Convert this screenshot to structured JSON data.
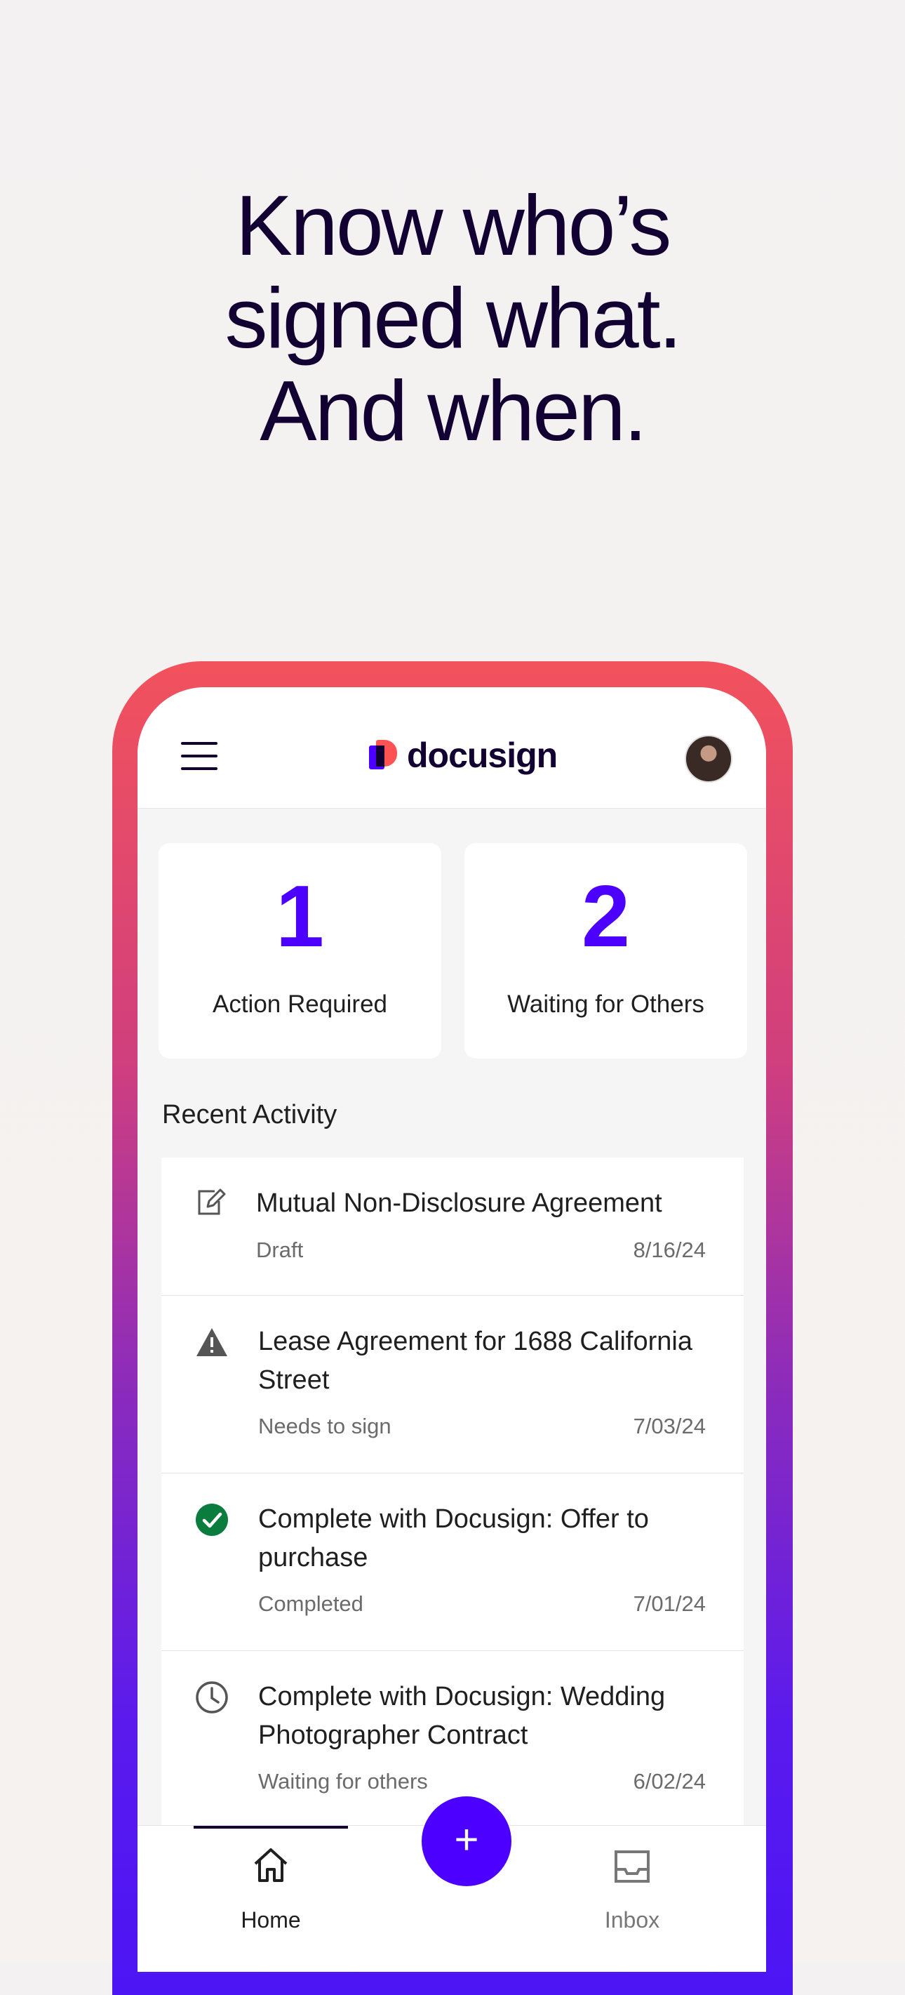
{
  "headline": {
    "line1": "Know who’s",
    "line2": "signed what.",
    "line3": "And when."
  },
  "app": {
    "logo_text": "docusign",
    "menu_icon": "hamburger-menu-icon",
    "avatar": "user-avatar"
  },
  "stats": [
    {
      "value": "1",
      "label": "Action Required"
    },
    {
      "value": "2",
      "label": "Waiting for Others"
    }
  ],
  "recent_activity": {
    "title": "Recent Activity",
    "items": [
      {
        "icon": "edit-icon",
        "title": "Mutual Non-Disclosure Agreement",
        "status": "Draft",
        "date": "8/16/24"
      },
      {
        "icon": "warning-icon",
        "title": "Lease Agreement for 1688 California Street",
        "status": "Needs to sign",
        "date": "7/03/24"
      },
      {
        "icon": "check-circle-icon",
        "title": "Complete with Docusign: Offer to purchase",
        "status": "Completed",
        "date": "7/01/24"
      },
      {
        "icon": "clock-icon",
        "title": "Complete with Docusign: Wedding Photographer Contract",
        "status": "Waiting for others",
        "date": "6/02/24"
      }
    ]
  },
  "bottom_nav": {
    "home_label": "Home",
    "inbox_label": "Inbox",
    "fab_label": "+"
  },
  "colors": {
    "accent": "#4c00ff",
    "brand_dark": "#130032",
    "brand_red": "#ff5252",
    "success": "#0a7d3e"
  }
}
